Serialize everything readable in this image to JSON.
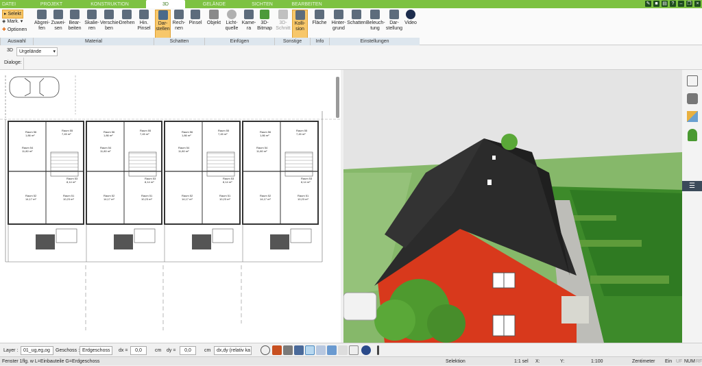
{
  "tabs": [
    "DATEI",
    "PROJEKT",
    "KONSTRUKTION",
    "3D",
    "GELÄNDE",
    "SICHTEN",
    "BEARBEITEN"
  ],
  "selection": {
    "select": "Selekt",
    "mark": "Mark.",
    "options": "Optionen"
  },
  "buttons": [
    "Abgrei-\nfen",
    "Zuwei-\nsen",
    "Bear-\nbeiten",
    "Skalie-\nren",
    "Verschie-\nben",
    "Drehen",
    "Hin.\nPinsel",
    "Dar-\nstellen",
    "Rech-\nnen",
    "Pinsel",
    "Objekt",
    "Licht-\nquelle",
    "Kame-\nra",
    "3D-\nBitmap",
    "3D-\nSchnitt",
    "Kolli-\nsion",
    "Fläche",
    "Hinter-\ngrund",
    "Schatten",
    "Beleuch-\ntung",
    "Dar-\nstellung",
    "Video"
  ],
  "groups": [
    "Auswahl",
    "Material",
    "Schatten",
    "Einfügen",
    "Sonstige",
    "Info",
    "Einstellungen"
  ],
  "view": {
    "mode": "3D",
    "terrain": "Urgelände"
  },
  "dialog_label": "Dialoge:",
  "bottom": {
    "layer_label": "Layer :",
    "layer_value": "01_ug,eg,og",
    "floor_label": "Geschoss :",
    "floor_value": "Erdgeschoss",
    "dx_label": "dx =",
    "dx_value": "0,0",
    "dx_unit": "cm",
    "dy_label": "dy =",
    "dy_value": "0,0",
    "dy_unit": "cm",
    "mode_value": "dx,dy (relativ ka"
  },
  "status": {
    "hint": "Fenster 1flg. w L=Einbauteile G=Erdgeschoss",
    "mode": "Selektion",
    "sel": "1:1 sel",
    "x": "X:",
    "y": "Y:",
    "scale": "1:100",
    "unit": "Zentimeter",
    "ein": "Ein",
    "uf": "UF",
    "num": "NUM",
    "rf": "RF"
  },
  "rooms": [
    "Raum 56",
    "Raum 55",
    "Raum 54",
    "Raum 53",
    "Raum 52",
    "Raum 51"
  ],
  "room_areas": [
    "1,86 m²",
    "7,45 m²",
    "11,80 m²",
    "8,14 m²",
    "14,17 m²",
    "10,23 m²"
  ],
  "colors": {
    "green": "#7dc242",
    "accent": "#f7c76a",
    "wall": "#d8391c",
    "roof": "#2b2b2b"
  }
}
